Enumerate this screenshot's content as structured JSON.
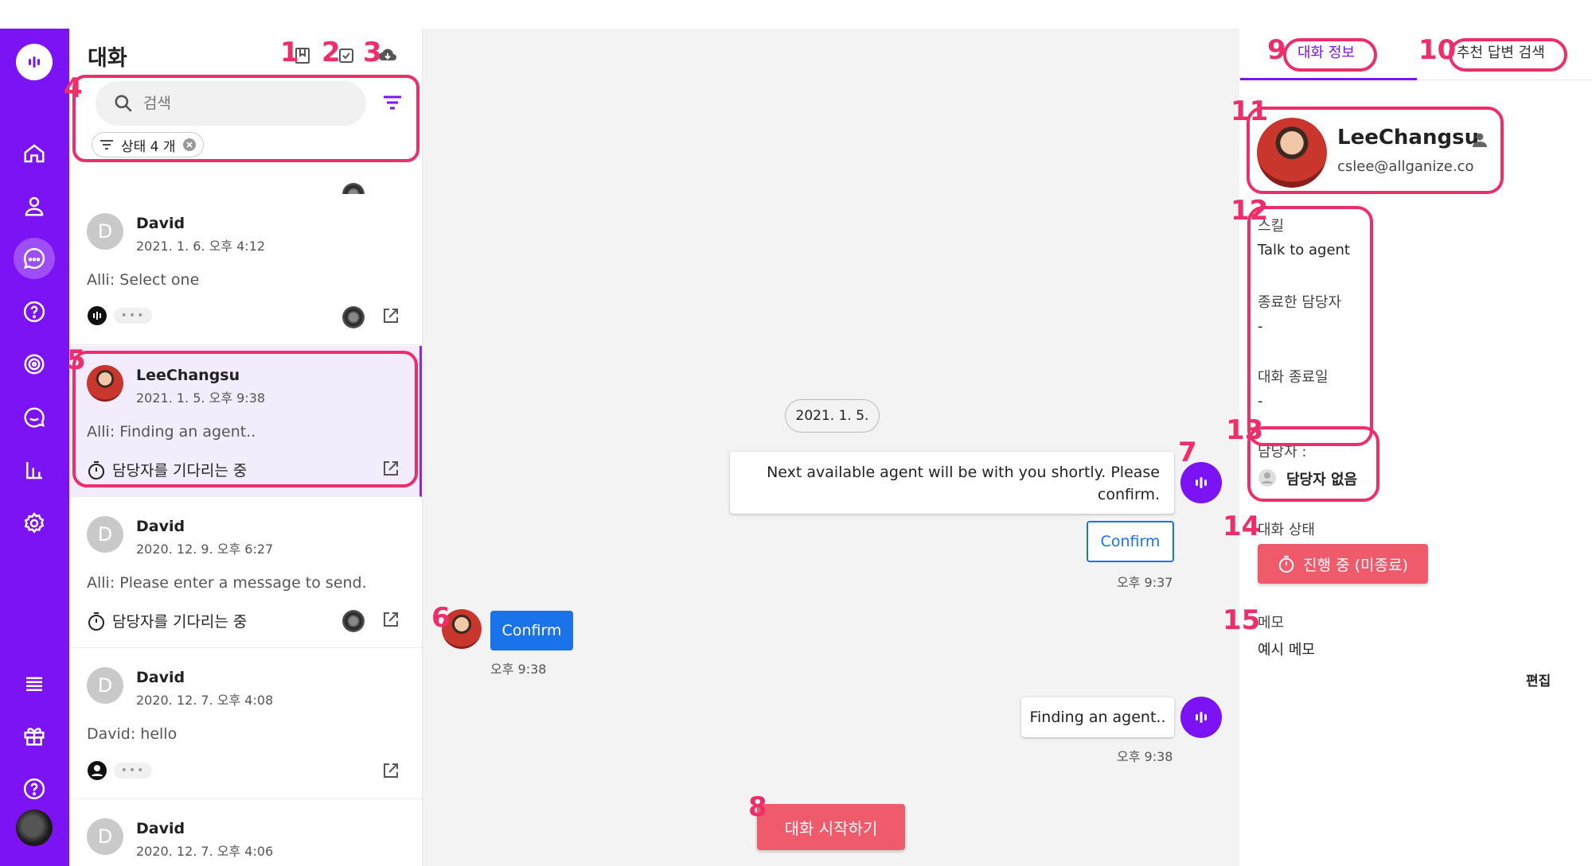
{
  "nav": {
    "items": [
      "home-icon",
      "contacts-icon",
      "conversations-icon",
      "faq-icon",
      "campaign-icon",
      "chat-icon",
      "analytics-icon",
      "settings-icon",
      "list-icon",
      "gift-icon",
      "help-icon"
    ],
    "active": "conversations-icon"
  },
  "list": {
    "title": "대화",
    "search_placeholder": "검색",
    "filter_chip": "상태 4 개",
    "conversations": [
      {
        "name": "David",
        "initial": "D",
        "date": "2021. 1. 6. 오후 4:12",
        "message": "Alli: Select one",
        "status": ""
      },
      {
        "name": "LeeChangsu",
        "initial": "",
        "date": "2021. 1. 5. 오후 9:38",
        "message": "Alli: Finding an agent..",
        "status": "담당자를 기다리는 중"
      },
      {
        "name": "David",
        "initial": "D",
        "date": "2020. 12. 9. 오후 6:27",
        "message": "Alli: Please enter a message to send.",
        "status": "담당자를 기다리는 중"
      },
      {
        "name": "David",
        "initial": "D",
        "date": "2020. 12. 7. 오후 4:08",
        "message": "David: hello",
        "status": ""
      },
      {
        "name": "David",
        "initial": "D",
        "date": "2020. 12. 7. 오후 4:06",
        "message": "",
        "status": ""
      }
    ]
  },
  "chat": {
    "date": "2021. 1. 5.",
    "bot_message": "Next available agent will be with you shortly. Please confirm.",
    "confirm_option": "Confirm",
    "bot_time": "오후 9:37",
    "user_reply": "Confirm",
    "user_time": "오후 9:38",
    "bot_message_2": "Finding an agent..",
    "bot_time_2": "오후 9:38",
    "start_button": "대화 시작하기"
  },
  "info": {
    "tab_info": "대화 정보",
    "tab_search": "추천 답변 검색",
    "profile_name": "LeeChangsu",
    "profile_email": "cslee@allganize.co",
    "skill_label": "스킬",
    "skill_value": "Talk to agent",
    "ended_agent_label": "종료한 담당자",
    "ended_agent_value": "-",
    "end_date_label": "대화 종료일",
    "end_date_value": "-",
    "agent_label": "담당자 :",
    "agent_value": "담당자 없음",
    "status_label": "대화 상태",
    "status_button": "진행 중 (미종료)",
    "memo_label": "메모",
    "memo_value": "예시 메모",
    "edit_label": "편집"
  },
  "annotations": [
    "1",
    "2",
    "3",
    "4",
    "5",
    "6",
    "7",
    "8",
    "9",
    "10",
    "11",
    "12",
    "13",
    "14",
    "15"
  ],
  "colors": {
    "brand": "#7c13f5",
    "accent_red": "#ef5b6b",
    "annotation": "#ec2f6a",
    "link_blue": "#1a73e8"
  }
}
